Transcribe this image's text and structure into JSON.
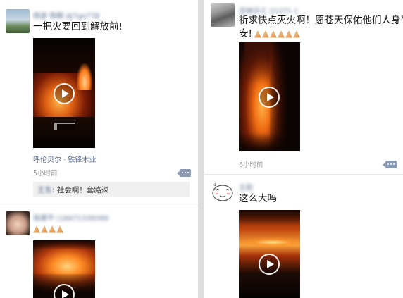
{
  "posts": {
    "left_top": {
      "username": "杨淑 熟脚 @7ge778",
      "text": "一把火要回到解放前!",
      "location": "呼伦贝尔 · 铁锋木业",
      "time": "5小时前",
      "comment": {
        "author": "王东",
        "separator": ": ",
        "text": "社会啊！套路深"
      }
    },
    "left_bottom": {
      "username": "张建平 (18471339399"
    },
    "right_top": {
      "username": "吕纳马工 21271 1",
      "text_line1": "祈求快点灭火啊！愿苍天保佑他们人身平",
      "text_line2": "安!",
      "time": "6小时前"
    },
    "right_bottom": {
      "username": "王莉",
      "text": "这么大吗"
    }
  },
  "icons": {
    "play": "play-icon",
    "comment": "comment-icon",
    "emoji": "folded-hands-emoji"
  },
  "colors": {
    "link": "#5a6d8f",
    "time": "#999999",
    "comment_button": "#8a9ab2"
  }
}
